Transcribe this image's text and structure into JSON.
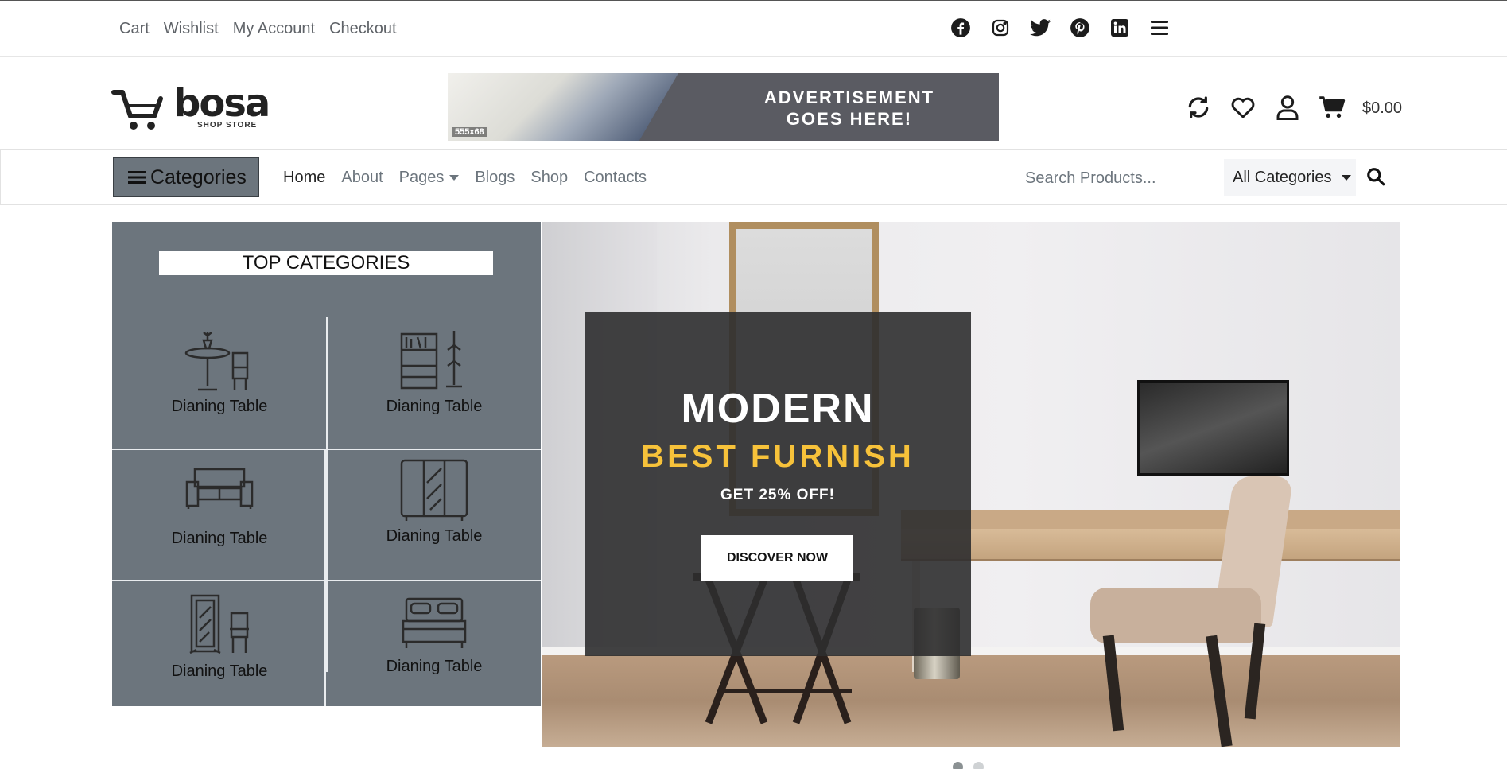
{
  "topbar": {
    "links": [
      "Cart",
      "Wishlist",
      "My Account",
      "Checkout"
    ],
    "social_icons": [
      "facebook-icon",
      "instagram-icon",
      "twitter-icon",
      "pinterest-icon",
      "linkedin-icon",
      "menu-icon"
    ]
  },
  "header": {
    "logo": {
      "name": "bosa",
      "tagline": "SHOP STORE"
    },
    "ad": {
      "line1": "ADVERTISEMENT",
      "line2": "GOES HERE!",
      "size_label": "555x68"
    },
    "icons": [
      "refresh-icon",
      "heart-icon",
      "user-icon",
      "cart-icon"
    ],
    "cart_total": "$0.00"
  },
  "nav": {
    "categories_button": "Categories",
    "links": [
      "Home",
      "About",
      "Pages",
      "Blogs",
      "Shop",
      "Contacts"
    ],
    "search_placeholder": "Search Products...",
    "category_select": "All Categories"
  },
  "categories_panel": {
    "title": "TOP CATEGORIES",
    "items": [
      {
        "label": "Dianing Table",
        "icon": "dining-table-icon"
      },
      {
        "label": "Dianing Table",
        "icon": "bookshelf-icon"
      },
      {
        "label": "Dianing Table",
        "icon": "sofa-icon"
      },
      {
        "label": "Dianing Table",
        "icon": "wardrobe-icon"
      },
      {
        "label": "Dianing Table",
        "icon": "mirror-chair-icon"
      },
      {
        "label": "Dianing Table",
        "icon": "bed-icon"
      }
    ]
  },
  "hero": {
    "headline": "MODERN",
    "subheadline": "BEST FURNISH",
    "offer": "GET 25% OFF!",
    "cta": "DISCOVER NOW"
  },
  "colors": {
    "panel_gray": "#6c757d",
    "accent_yellow": "#f7c23a",
    "text_dark": "#212529",
    "text_muted": "#6c757d"
  },
  "slider": {
    "slides": 2,
    "active_index": 0
  }
}
